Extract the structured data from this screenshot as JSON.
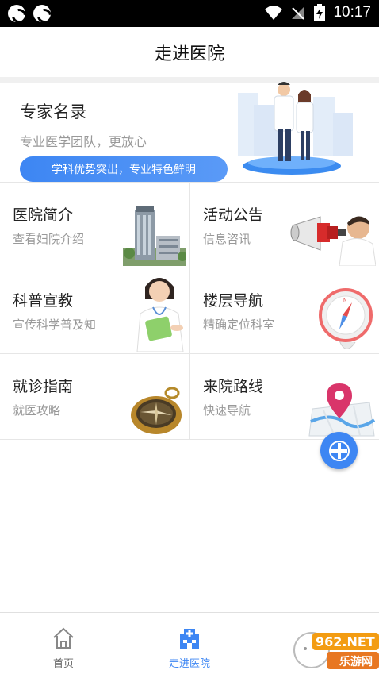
{
  "status_bar": {
    "time": "10:17"
  },
  "app_bar": {
    "title": "走进医院"
  },
  "banner": {
    "title": "专家名录",
    "subtitle": "专业医学团队，更放心",
    "pill": "学科优势突出，专业特色鲜明"
  },
  "grid": [
    {
      "title": "医院简介",
      "subtitle": "查看妇院介绍",
      "icon": "hospital-building"
    },
    {
      "title": "活动公告",
      "subtitle": "信息咨讯",
      "icon": "megaphone"
    },
    {
      "title": "科普宣教",
      "subtitle": "宣传科学普及知",
      "icon": "nurse"
    },
    {
      "title": "楼层导航",
      "subtitle": "精确定位科室",
      "icon": "compass"
    },
    {
      "title": "就诊指南",
      "subtitle": "就医攻略",
      "icon": "pocket-compass"
    },
    {
      "title": "来院路线",
      "subtitle": "快速导航",
      "icon": "map-pin"
    }
  ],
  "bottom_nav": [
    {
      "label": "首页",
      "icon": "home-icon",
      "active": false
    },
    {
      "label": "走进医院",
      "icon": "hospital-icon",
      "active": true
    }
  ],
  "watermark": {
    "text_top": "962.NET",
    "text_bottom": "乐游网"
  },
  "colors": {
    "accent": "#3d86f3",
    "inactive": "#666666"
  }
}
